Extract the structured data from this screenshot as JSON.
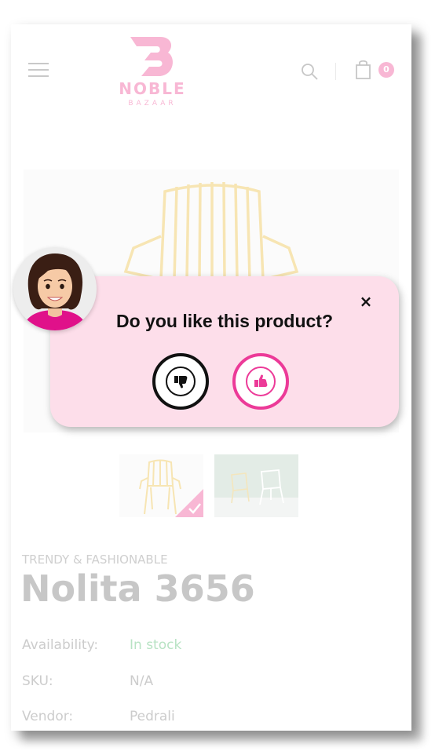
{
  "header": {
    "menu_icon": "hamburger-menu-icon",
    "brand_name": "NOBLE",
    "brand_sub": "BAZAAR",
    "brand_color": "#f8b7d4",
    "search_icon": "search-icon",
    "cart_icon": "shopping-bag-icon",
    "cart_count": "0"
  },
  "product": {
    "eyebrow": "TRENDY & FASHIONABLE",
    "name": "Nolita 3656",
    "details": [
      {
        "label": "Availability:",
        "value": "In stock"
      },
      {
        "label": "SKU:",
        "value": "N/A"
      },
      {
        "label": "Vendor:",
        "value": "Pedrali"
      }
    ],
    "availability_color": "#b8e3c4"
  },
  "popup": {
    "question": "Do you like this product?",
    "close_glyph": "×",
    "dislike_icon": "thumbs-down-icon",
    "like_icon": "thumbs-up-icon",
    "background": "#fddeea",
    "accent": "#ec3a98"
  }
}
